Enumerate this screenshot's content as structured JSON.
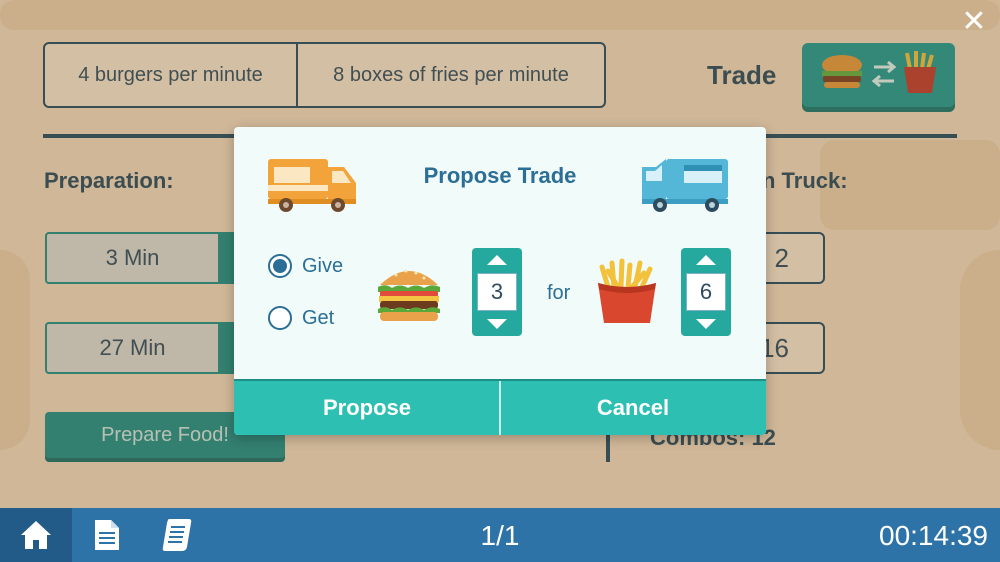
{
  "background": {
    "rate_burgers": "4 burgers per minute",
    "rate_fries": "8 boxes of fries per minute",
    "trade_label": "Trade",
    "preparation_label": "Preparation:",
    "truck_label": "n Truck:",
    "prep_times": [
      "3 Min",
      "27 Min"
    ],
    "truck_values": [
      "2",
      "16"
    ],
    "prepare_button": "Prepare Food!",
    "combos": "Combos: 12",
    "close_glyph": "✕"
  },
  "modal": {
    "title": "Propose Trade",
    "left_truck_icon": "orange-food-truck-icon",
    "right_truck_icon": "blue-food-truck-icon",
    "options": {
      "give_label": "Give",
      "get_label": "Get",
      "selected": "Give"
    },
    "give_item_icon": "burger-icon",
    "give_quantity": "3",
    "for_label": "for",
    "get_item_icon": "fries-icon",
    "get_quantity": "6",
    "propose_button": "Propose",
    "cancel_button": "Cancel"
  },
  "bottom_bar": {
    "icons": [
      "home-icon",
      "document-icon",
      "scroll-icon"
    ],
    "page_counter": "1/1",
    "timer": "00:14:39"
  },
  "colors": {
    "accent_teal": "#2dbfb2",
    "title_blue": "#2b6e96",
    "bar_blue": "#2e73a8",
    "background_tan": "#f3dcc0"
  }
}
